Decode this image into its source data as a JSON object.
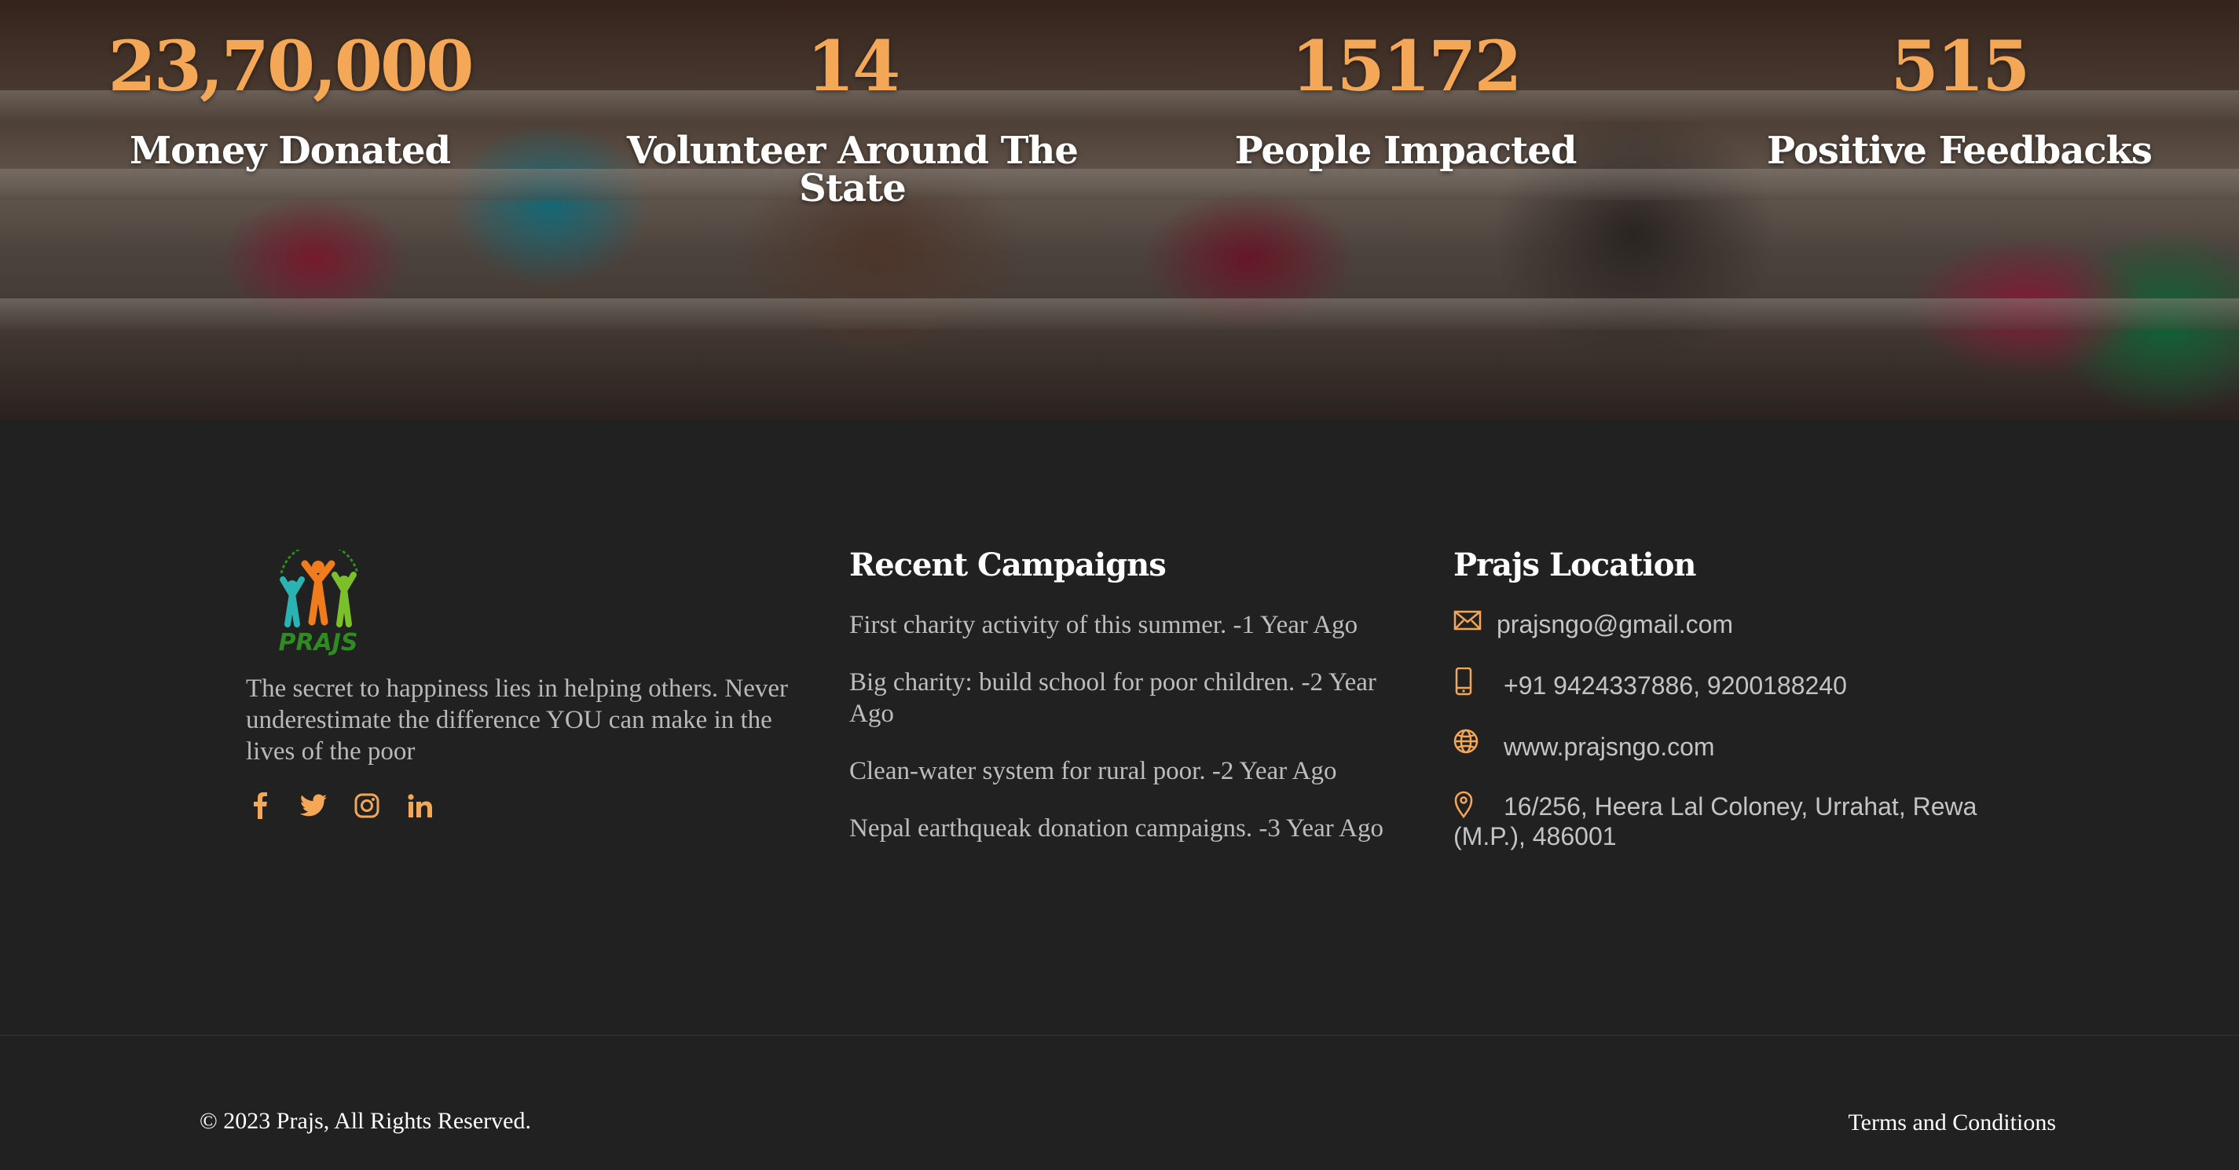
{
  "stats": [
    {
      "value": "23,70,000",
      "label": "Money Donated"
    },
    {
      "value": "14",
      "label": "Volunteer Around The State"
    },
    {
      "value": "15172",
      "label": "People Impacted"
    },
    {
      "value": "515",
      "label": "Positive Feedbacks"
    }
  ],
  "brand": {
    "logo_text": "PRAJS",
    "tagline": "The secret to happiness lies in helping others. Never underestimate the difference YOU can make in the lives of the poor"
  },
  "social": [
    "facebook-icon",
    "twitter-icon",
    "instagram-icon",
    "linkedin-icon"
  ],
  "campaigns": {
    "heading": "Recent Campaigns",
    "items": [
      "First charity activity of this summer. -1 Year Ago",
      "Big charity: build school for poor children. -2 Year Ago",
      "Clean-water system for rural poor. -2 Year Ago",
      "Nepal earthqueak donation campaigns. -3 Year Ago"
    ]
  },
  "location": {
    "heading": "Prajs Location",
    "email": "prajsngo@gmail.com",
    "phone": "+91 9424337886, 9200188240",
    "website": "www.prajsngo.com",
    "address": "16/256, Heera Lal Coloney, Urrahat, Rewa (M.P.), 486001"
  },
  "footer": {
    "copyright": "© 2023 Prajs, All Rights Reserved.",
    "terms": "Terms and Conditions"
  },
  "colors": {
    "accent": "#f4a756",
    "background": "#212121",
    "logo_green": "#2e8b1f"
  }
}
